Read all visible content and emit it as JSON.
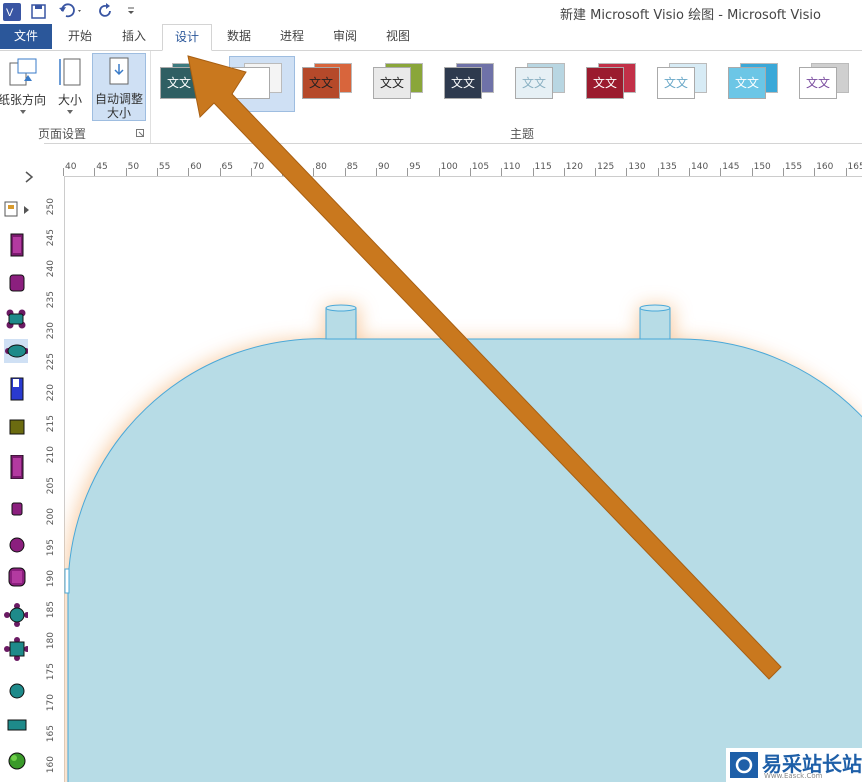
{
  "window": {
    "title": "新建 Microsoft Visio 绘图 - Microsoft Visio"
  },
  "quick_access": {
    "app_icon": "visio-logo-icon",
    "save_icon": "save-icon",
    "undo_icon": "undo-icon",
    "redo_icon": "redo-icon",
    "customize_icon": "customize-qat-icon"
  },
  "tabs": [
    {
      "label": "文件"
    },
    {
      "label": "开始"
    },
    {
      "label": "插入"
    },
    {
      "label": "设计"
    },
    {
      "label": "数据"
    },
    {
      "label": "进程"
    },
    {
      "label": "审阅"
    },
    {
      "label": "视图"
    }
  ],
  "ribbon": {
    "page_setup": {
      "group_label": "页面设置",
      "orientation_label": "纸张方向",
      "size_label": "大小",
      "autosize_label_line1": "自动调整",
      "autosize_label_line2": "大小"
    },
    "themes": {
      "group_label": "主题",
      "items": [
        {
          "text": "文文",
          "front": "#2f5f63",
          "back": "#3d7b80",
          "fg": "#ffffff"
        },
        {
          "text": "",
          "front": "#ffffff",
          "back": "#f4f4f4",
          "fg": "#333333"
        },
        {
          "text": "文文",
          "front": "#b5492a",
          "back": "#d8653c",
          "fg": "#222222"
        },
        {
          "text": "文文",
          "front": "#e9e9e9",
          "back": "#8aa63a",
          "fg": "#222222"
        },
        {
          "text": "文文",
          "front": "#2e3a4e",
          "back": "#6f72a8",
          "fg": "#ffffff"
        },
        {
          "text": "文文",
          "front": "#e6f0f5",
          "back": "#b8d6e2",
          "fg": "#8ab0c2"
        },
        {
          "text": "文文",
          "front": "#9b1b2e",
          "back": "#c23048",
          "fg": "#ffffff"
        },
        {
          "text": "文文",
          "front": "#ffffff",
          "back": "#d7ebf5",
          "fg": "#6aa8c8"
        },
        {
          "text": "文文",
          "front": "#6cc6e6",
          "back": "#3aa8d8",
          "fg": "#ffffff"
        },
        {
          "text": "文文",
          "front": "#ffffff",
          "back": "#cfcfcf",
          "fg": "#7b4ea0"
        }
      ]
    }
  },
  "ruler_top": [
    "40",
    "45",
    "50",
    "55",
    "60",
    "65",
    "70",
    "75",
    "80",
    "85",
    "90",
    "95",
    "100",
    "105",
    "110",
    "115",
    "120",
    "125",
    "130",
    "135",
    "140",
    "145",
    "150",
    "155",
    "160",
    "165"
  ],
  "ruler_left": [
    "250",
    "245",
    "240",
    "235",
    "230",
    "225",
    "220",
    "215",
    "210",
    "205",
    "200",
    "195",
    "190",
    "185",
    "180",
    "175",
    "170",
    "165",
    "160"
  ],
  "stencil": {
    "expand_icon": "chevron-right-icon",
    "shapes_icon": "stencil-menu-icon",
    "shape_icons": [
      "door-icon",
      "chair-icon",
      "table-round-4-icon",
      "table-oval-icon",
      "window-icon",
      "cabinet-icon",
      "tall-door-icon",
      "small-chair-icon",
      "round-stool-icon",
      "armchair-icon",
      "round-table-icon",
      "square-table-icon",
      "circle-icon",
      "rectangle-icon",
      "plant-icon"
    ]
  },
  "canvas": {
    "shape": "rounded-pool-shape",
    "fill": "#b7dce6",
    "stroke": "#4aa8d8",
    "glow": "#f7c89c",
    "arrow_color": "#c9781e"
  },
  "watermark": {
    "text": "易采站长站",
    "sub": "Www.Easck.Com"
  }
}
